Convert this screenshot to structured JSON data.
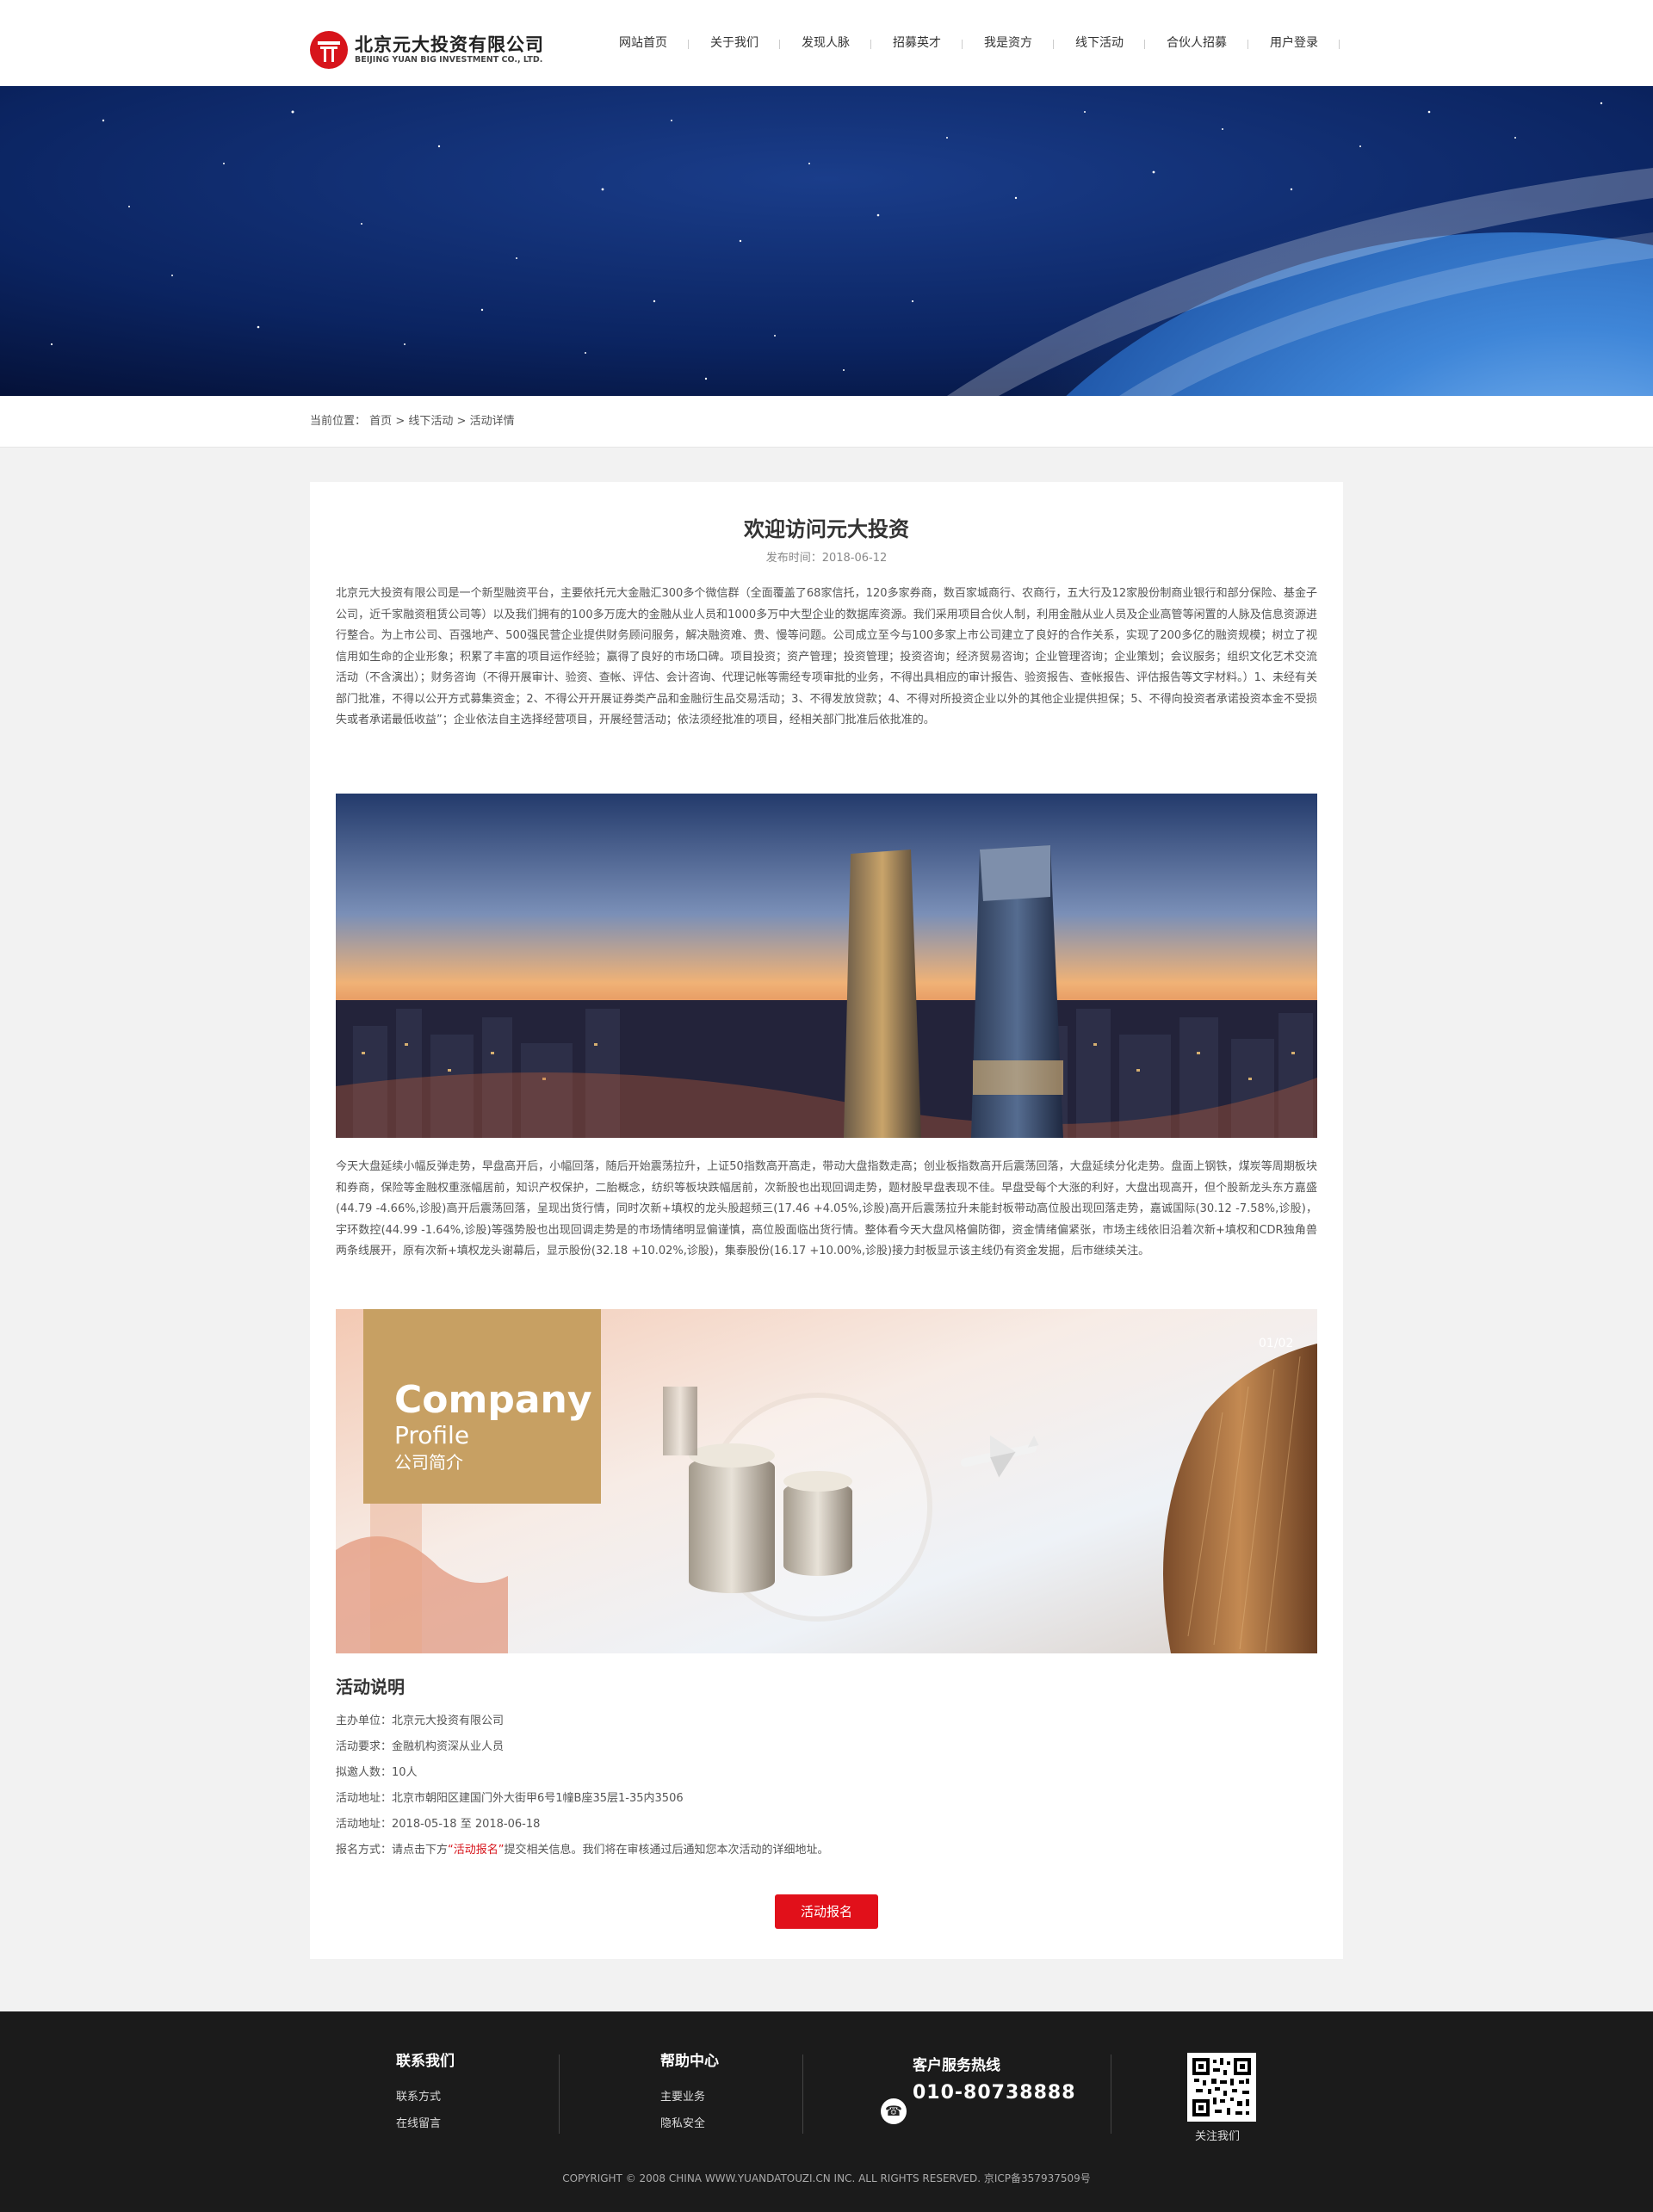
{
  "header": {
    "company_cn": "北京元大投资有限公司",
    "company_en": "BEIJING YUAN BIG INVESTMENT CO., LTD.",
    "nav": [
      {
        "label": "网站首页"
      },
      {
        "label": "关于我们"
      },
      {
        "label": "发现人脉"
      },
      {
        "label": "招募英才"
      },
      {
        "label": "我是资方"
      },
      {
        "label": "线下活动"
      },
      {
        "label": "合伙人招募"
      },
      {
        "label": "用户登录"
      }
    ]
  },
  "breadcrumb": {
    "prefix": "当前位置：",
    "items": [
      "首页",
      "线下活动",
      "活动详情"
    ],
    "separator": ">"
  },
  "article": {
    "title": "欢迎访问元大投资",
    "date_label": "发布时间：",
    "date": "2018-06-12",
    "paragraph1": "北京元大投资有限公司是一个新型融资平台，主要依托元大金融汇300多个微信群（全面覆盖了68家信托，120多家券商，数百家城商行、农商行，五大行及12家股份制商业银行和部分保险、基金子公司，近千家融资租赁公司等）以及我们拥有的100多万庞大的金融从业人员和1000多万中大型企业的数据库资源。我们采用项目合伙人制，利用金融从业人员及企业高管等闲置的人脉及信息资源进行整合。为上市公司、百强地产、500强民营企业提供财务顾问服务，解决融资难、贵、慢等问题。公司成立至今与100多家上市公司建立了良好的合作关系，实现了200多亿的融资规模；树立了视信用如生命的企业形象；积累了丰富的项目运作经验；赢得了良好的市场口碑。项目投资；资产管理；投资管理；投资咨询；经济贸易咨询；企业管理咨询；企业策划；会议服务；组织文化艺术交流活动（不含演出）；财务咨询（不得开展审计、验资、查帐、评估、会计咨询、代理记帐等需经专项审批的业务，不得出具相应的审计报告、验资报告、查帐报告、评估报告等文字材料。）1、未经有关部门批准，不得以公开方式募集资金；2、不得公开开展证券类产品和金融衍生品交易活动；3、不得发放贷款；4、不得对所投资企业以外的其他企业提供担保；5、不得向投资者承诺投资本金不受损失或者承诺最低收益”；企业依法自主选择经营项目，开展经营活动；依法须经批准的项目，经相关部门批准后依批准的。",
    "paragraph2": "今天大盘延续小幅反弹走势，早盘高开后，小幅回落，随后开始震荡拉升，上证50指数高开高走，带动大盘指数走高；创业板指数高开后震荡回落，大盘延续分化走势。盘面上钢铁，煤炭等周期板块和券商，保险等金融权重涨幅居前，知识产权保护，二胎概念，纺织等板块跌幅居前，次新股也出现回调走势，题材股早盘表现不佳。早盘受每个大涨的利好，大盘出现高开，但个股新龙头东方嘉盛(44.79 -4.66%,诊股)高开后震荡回落，呈现出货行情，同时次新+填权的龙头股超频三(17.46 +4.05%,诊股)高开后震荡拉升未能封板带动高位股出现回落走势，嘉诚国际(30.12 -7.58%,诊股)，宇环数控(44.99 -1.64%,诊股)等强势股也出现回调走势是的市场情绪明显偏谨慎，高位股面临出货行情。整体看今天大盘风格偏防御，资金情绪偏紧张，市场主线依旧沿着次新+填权和CDR独角兽两条线展开，原有次新+填权龙头谢幕后，显示股份(32.18 +10.02%,诊股)，集泰股份(16.17 +10.00%,诊股)接力封板显示该主线仍有资金发掘，后市继续关注。",
    "slide_counter": "01/02",
    "promo_title": "Company",
    "promo_sub": "Profile",
    "promo_cn": "公司简介",
    "section_title": "活动说明",
    "info": [
      {
        "label": "主办单位：",
        "value": "北京元大投资有限公司"
      },
      {
        "label": "活动要求：",
        "value": "金融机构资深从业人员"
      },
      {
        "label": "拟邀人数：",
        "value": "10人"
      },
      {
        "label": "活动地址：",
        "value": "北京市朝阳区建国门外大街甲6号1幢B座35层1-35内3506"
      },
      {
        "label": "活动地址：",
        "value": "2018-05-18 至 2018-06-18"
      }
    ],
    "signup_prefix": "报名方式：请点击下方",
    "signup_highlight": "“活动报名”",
    "signup_suffix": "提交相关信息。我们将在审核通过后通知您本次活动的详细地址。",
    "button": "活动报名"
  },
  "footer": {
    "col1": {
      "title": "联系我们",
      "links": [
        "联系方式",
        "在线留言"
      ]
    },
    "col2": {
      "title": "帮助中心",
      "links": [
        "主要业务",
        "隐私安全"
      ]
    },
    "hotline_title": "客户服务热线",
    "hotline": "010-80738888",
    "qr_label": "关注我们",
    "copyright": "COPYRIGHT © 2008 CHINA WWW.YUANDATOUZI.CN INC. ALL RIGHTS RESERVED. 京ICP备357937509号"
  },
  "colors": {
    "accent": "#e1101a",
    "footer_bg": "#1b1b1b",
    "promo_box": "#c7a063"
  }
}
